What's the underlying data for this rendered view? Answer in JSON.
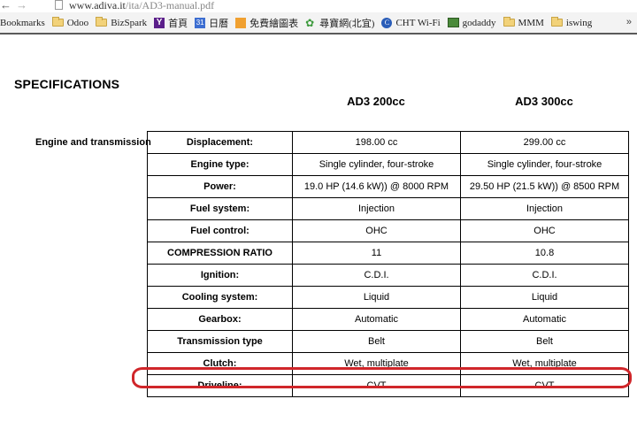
{
  "browser": {
    "url_host": "www.adiva.it",
    "url_path": "/ita/AD3-manual.pdf",
    "bookmarks": [
      {
        "label": "Bookmarks",
        "icon": "none"
      },
      {
        "label": "Odoo",
        "icon": "folder-icon"
      },
      {
        "label": "BizSpark",
        "icon": "folder-icon"
      },
      {
        "label": "首頁",
        "icon": "yahoo-icon",
        "glyph": "Y"
      },
      {
        "label": "日曆",
        "icon": "calendar-icon",
        "glyph": "31"
      },
      {
        "label": "免費繪圖表",
        "icon": "orange-app-icon",
        "glyph": ""
      },
      {
        "label": "尋寶網(北宜)",
        "icon": "leaf-icon",
        "glyph": "✿"
      },
      {
        "label": "CHT Wi-Fi",
        "icon": "cht-icon",
        "glyph": "C"
      },
      {
        "label": "godaddy",
        "icon": "image-icon"
      },
      {
        "label": "MMM",
        "icon": "folder-icon"
      },
      {
        "label": "iswing",
        "icon": "folder-icon"
      }
    ],
    "overflow_glyph": "»"
  },
  "document": {
    "title": "SPECIFICATIONS",
    "columns": [
      "AD3  200cc",
      "AD3  300cc"
    ],
    "section": "Engine and transmission",
    "rows": [
      {
        "label": "Displacement:",
        "v1": "198.00 cc",
        "v2": "299.00 cc"
      },
      {
        "label": "Engine type:",
        "v1": "Single cylinder, four-stroke",
        "v2": "Single cylinder, four-stroke"
      },
      {
        "label": "Power:",
        "v1": "19.0 HP (14.6 kW)) @ 8000 RPM",
        "v2": "29.50 HP (21.5 kW)) @ 8500 RPM"
      },
      {
        "label": "Fuel system:",
        "v1": "Injection",
        "v2": "Injection"
      },
      {
        "label": "Fuel control:",
        "v1": "OHC",
        "v2": "OHC"
      },
      {
        "label": "COMPRESSION RATIO",
        "v1": "11",
        "v2": "10.8"
      },
      {
        "label": "Ignition:",
        "v1": "C.D.I.",
        "v2": "C.D.I."
      },
      {
        "label": "Cooling system:",
        "v1": "Liquid",
        "v2": "Liquid"
      },
      {
        "label": "Gearbox:",
        "v1": "Automatic",
        "v2": "Automatic"
      },
      {
        "label": "Transmission type",
        "v1": "Belt",
        "v2": "Belt"
      },
      {
        "label": "Clutch:",
        "v1": "Wet, multiplate",
        "v2": "Wet, multiplate"
      },
      {
        "label": "Driveline:",
        "v1": "CVT",
        "v2": "CVT"
      }
    ],
    "highlight_color": "#d0262a"
  }
}
